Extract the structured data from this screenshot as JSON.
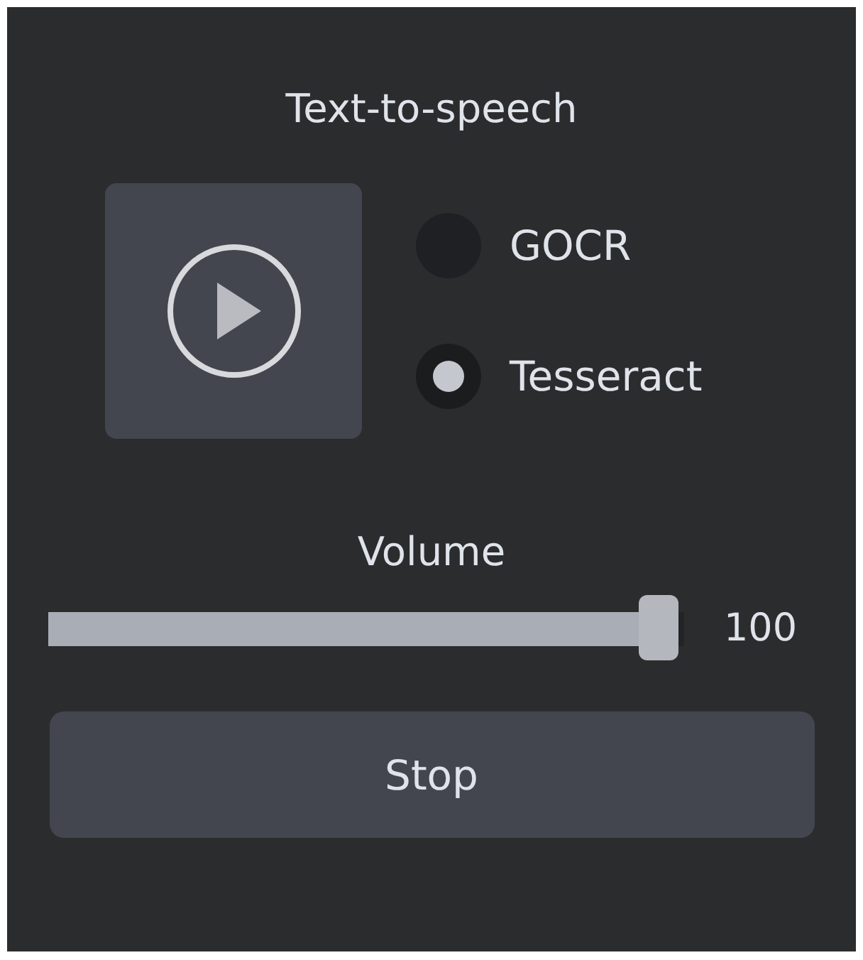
{
  "title": "Text-to-speech",
  "engines": [
    {
      "label": "GOCR",
      "selected": false
    },
    {
      "label": "Tesseract",
      "selected": true
    }
  ],
  "volume": {
    "label": "Volume",
    "level": 0.96,
    "reading": "100"
  },
  "buttons": [
    "Stop"
  ]
}
